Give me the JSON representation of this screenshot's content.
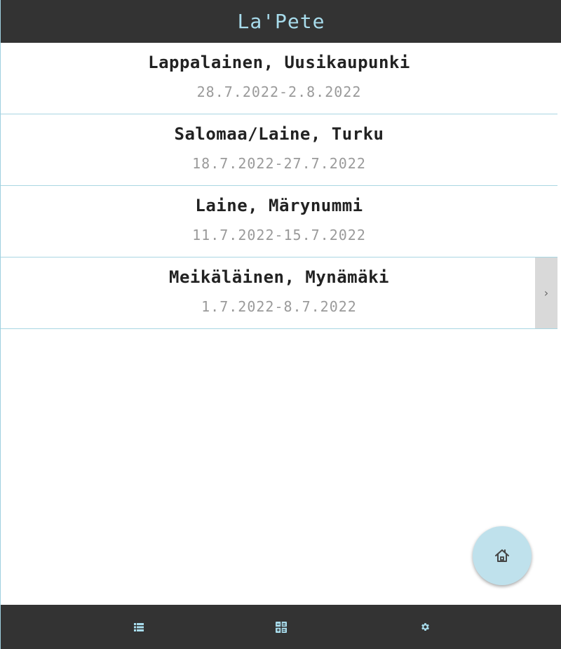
{
  "header": {
    "title": "La'Pete"
  },
  "trips": [
    {
      "name": "Lappalainen, Uusikaupunki",
      "dates": "28.7.2022-2.8.2022"
    },
    {
      "name": "Salomaa/Laine, Turku",
      "dates": "18.7.2022-27.7.2022"
    },
    {
      "name": "Laine, Märynummi",
      "dates": "11.7.2022-15.7.2022"
    },
    {
      "name": "Meikäläinen, Mynämäki",
      "dates": "1.7.2022-8.7.2022"
    }
  ],
  "swipe_handle": {
    "glyph": "›",
    "icon": "chevron-right-icon"
  },
  "fab": {
    "icon": "home-icon"
  },
  "bottom_nav": {
    "items": [
      {
        "icon": "list-icon"
      },
      {
        "icon": "calculator-icon"
      },
      {
        "icon": "gear-icon"
      }
    ]
  },
  "colors": {
    "bar_background": "#333333",
    "title_color": "#a8dcec",
    "accent": "#bfe1ec",
    "divider": "#a9d6e2",
    "date_text": "#9a9a9a",
    "icon_color": "#a8dcec"
  }
}
